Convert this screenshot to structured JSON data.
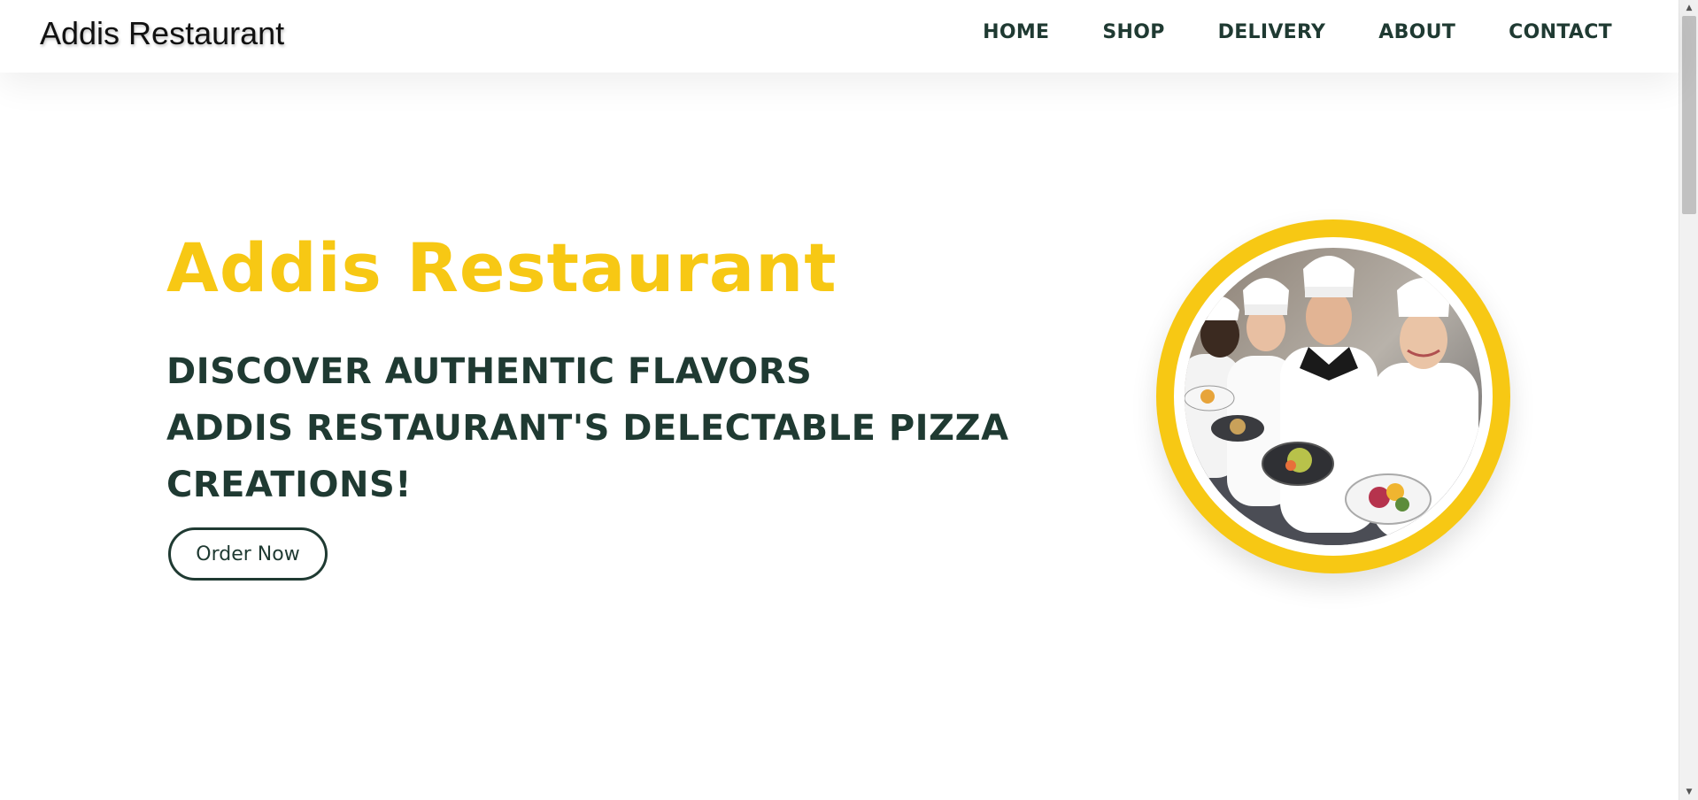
{
  "navbar": {
    "brand": "Addis Restaurant",
    "links": [
      {
        "label": "HOME"
      },
      {
        "label": "SHOP"
      },
      {
        "label": "DELIVERY"
      },
      {
        "label": "ABOUT"
      },
      {
        "label": "CONTACT"
      }
    ]
  },
  "hero": {
    "title": "Addis Restaurant",
    "subtitle_lines": [
      "DISCOVER AUTHENTIC FLAVORS",
      "ADDIS RESTAURANT'S DELECTABLE PIZZA",
      "CREATIONS!"
    ],
    "cta_label": "Order Now",
    "image": "chefs-holding-dishes-photo"
  },
  "colors": {
    "accent": "#f7c814",
    "text_dark": "#1f3a32",
    "background": "#ffffff"
  }
}
